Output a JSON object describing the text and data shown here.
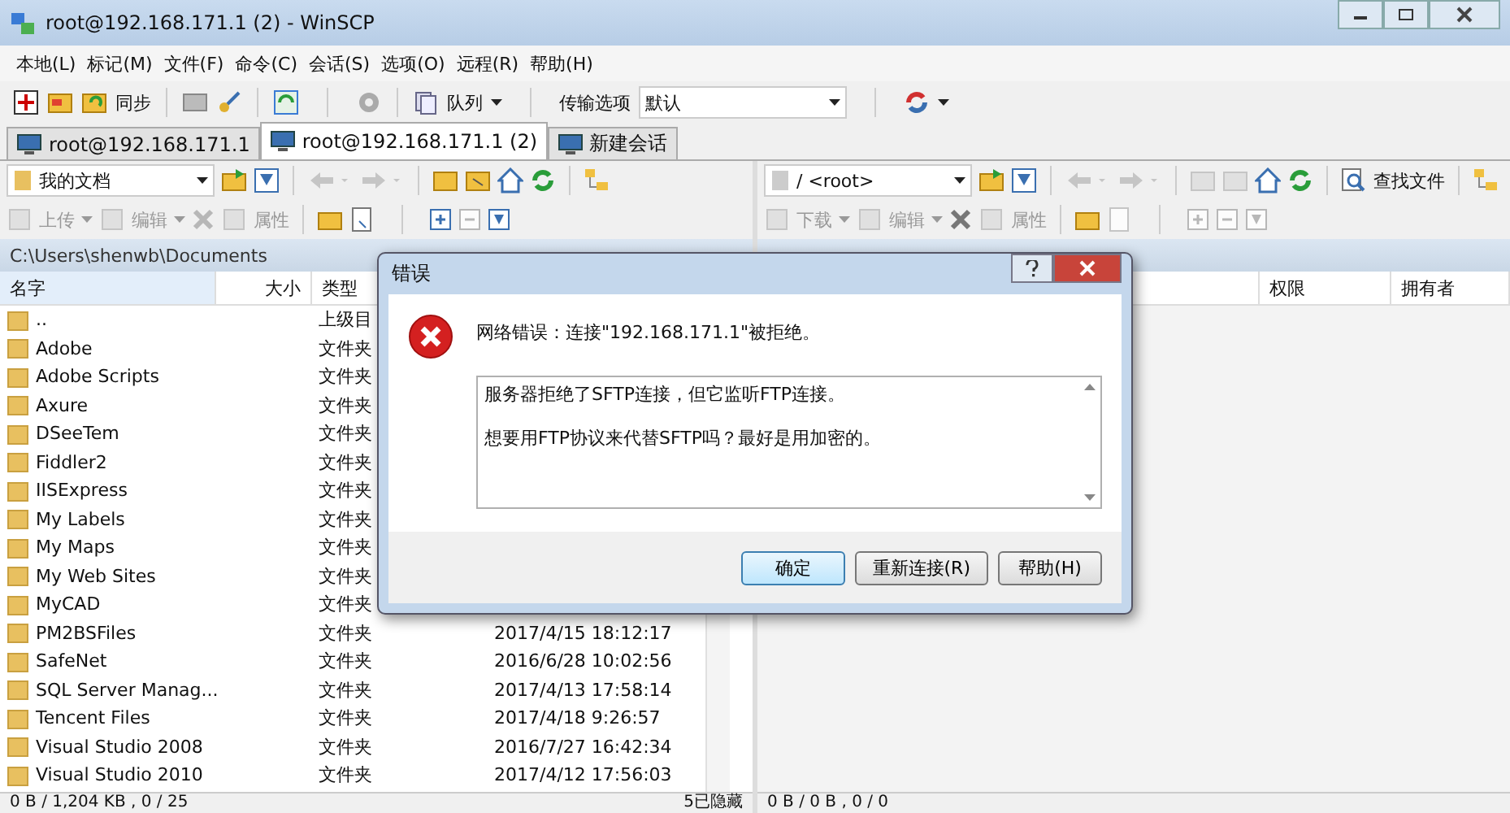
{
  "window": {
    "title": "root@192.168.171.1 (2) - WinSCP"
  },
  "menu": [
    "本地(L)",
    "标记(M)",
    "文件(F)",
    "命令(C)",
    "会话(S)",
    "选项(O)",
    "远程(R)",
    "帮助(H)"
  ],
  "toolbar": {
    "sync_label": "同步",
    "queue_label": "队列",
    "transfer_label": "传输选项",
    "transfer_value": "默认"
  },
  "session_tabs": [
    {
      "label": "root@192.168.171.1",
      "selected": false
    },
    {
      "label": "root@192.168.171.1 (2)",
      "selected": true
    },
    {
      "label": "新建会话",
      "selected": false
    }
  ],
  "left_panel": {
    "path_combo": "我的文档",
    "actions": [
      {
        "label": "上传",
        "disabled": true
      },
      {
        "label": "编辑",
        "disabled": true
      },
      {
        "label": "属性",
        "disabled": true
      }
    ],
    "path": "C:\\Users\\shenwb\\Documents",
    "columns": [
      "名字",
      "大小",
      "类型"
    ],
    "rows": [
      {
        "name": "..",
        "type": "上级目",
        "modified": ""
      },
      {
        "name": "Adobe",
        "type": "文件夹",
        "modified": ""
      },
      {
        "name": "Adobe Scripts",
        "type": "文件夹",
        "modified": ""
      },
      {
        "name": "Axure",
        "type": "文件夹",
        "modified": ""
      },
      {
        "name": "DSeeTem",
        "type": "文件夹",
        "modified": ""
      },
      {
        "name": "Fiddler2",
        "type": "文件夹",
        "modified": ""
      },
      {
        "name": "IISExpress",
        "type": "文件夹",
        "modified": ""
      },
      {
        "name": "My Labels",
        "type": "文件夹",
        "modified": ""
      },
      {
        "name": "My Maps",
        "type": "文件夹",
        "modified": ""
      },
      {
        "name": "My Web Sites",
        "type": "文件夹",
        "modified": ""
      },
      {
        "name": "MyCAD",
        "type": "文件夹",
        "modified": ""
      },
      {
        "name": "PM2BSFiles",
        "type": "文件夹",
        "modified": "2017/4/15  18:12:17"
      },
      {
        "name": "SafeNet",
        "type": "文件夹",
        "modified": "2016/6/28  10:02:56"
      },
      {
        "name": "SQL Server Manag...",
        "type": "文件夹",
        "modified": "2017/4/13  17:58:14"
      },
      {
        "name": "Tencent Files",
        "type": "文件夹",
        "modified": "2017/4/18  9:26:57"
      },
      {
        "name": "Visual Studio 2008",
        "type": "文件夹",
        "modified": "2016/7/27  16:42:34"
      },
      {
        "name": "Visual Studio 2010",
        "type": "文件夹",
        "modified": "2017/4/12  17:56:03"
      }
    ],
    "status": "0 B / 1,204 KB ,  0 / 25",
    "hidden_count": "5已隐藏"
  },
  "right_panel": {
    "path_combo": "/ <root>",
    "find_label": "查找文件",
    "actions": [
      {
        "label": "下载",
        "disabled": true
      },
      {
        "label": "编辑",
        "disabled": true
      },
      {
        "label": "属性",
        "disabled": true
      }
    ],
    "columns": [
      "权限",
      "拥有者"
    ],
    "status": "0 B / 0 B ,  0 / 0"
  },
  "dialog": {
    "title": "错误",
    "message": "网络错误：连接\"192.168.171.1\"被拒绝。",
    "details": [
      "服务器拒绝了SFTP连接，但它监听FTP连接。",
      "想要用FTP协议来代替SFTP吗？最好是用加密的。"
    ],
    "buttons": [
      {
        "label": "确定",
        "default": true
      },
      {
        "label": "重新连接(R)",
        "default": false
      },
      {
        "label": "帮助(H)",
        "default": false
      }
    ]
  }
}
